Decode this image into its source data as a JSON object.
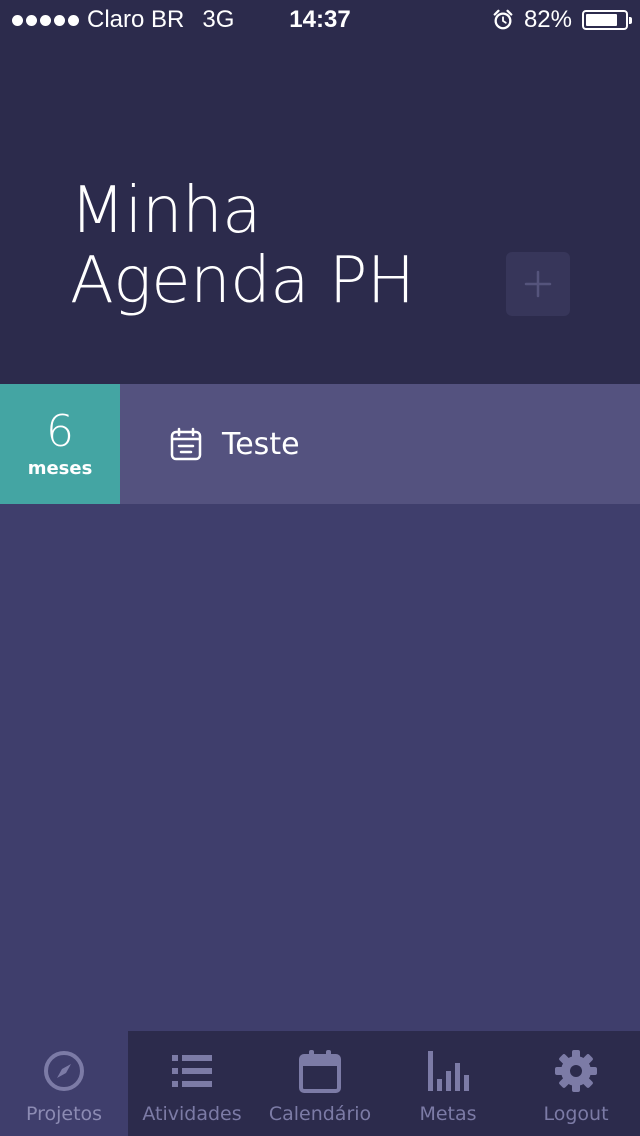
{
  "status_bar": {
    "carrier": "Claro BR",
    "network": "3G",
    "time": "14:37",
    "battery": "82%",
    "battery_level": 0.82
  },
  "header": {
    "title": "Minha Agenda PH",
    "add_button_label": "+"
  },
  "projects": [
    {
      "duration_value": "6",
      "duration_unit": "meses",
      "name": "Teste",
      "icon": "calendar-icon"
    }
  ],
  "tabs": [
    {
      "label": "Projetos",
      "icon": "compass-icon",
      "active": true
    },
    {
      "label": "Atividades",
      "icon": "list-icon",
      "active": false
    },
    {
      "label": "Calendário",
      "icon": "calendar-icon",
      "active": false
    },
    {
      "label": "Metas",
      "icon": "bar-chart-icon",
      "active": false
    },
    {
      "label": "Logout",
      "icon": "gear-icon",
      "active": false
    }
  ],
  "colors": {
    "header_bg": "#2c2b4c",
    "body_bg": "#3f3e6c",
    "row_bg": "#54527f",
    "badge_bg": "#44a5a3",
    "tab_inactive": "#7c7ba6"
  }
}
